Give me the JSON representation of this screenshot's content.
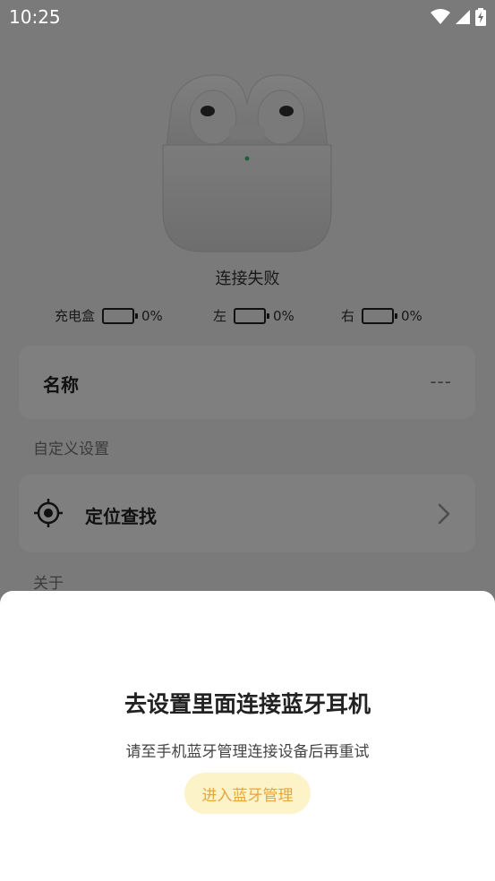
{
  "status_bar": {
    "time": "10:25"
  },
  "device": {
    "connection_status": "连接失败",
    "batteries": [
      {
        "label": "充电盒",
        "percent": "0%"
      },
      {
        "label": "左",
        "percent": "0%"
      },
      {
        "label": "右",
        "percent": "0%"
      }
    ],
    "name_label": "名称",
    "name_value": "---"
  },
  "sections": {
    "custom_settings": "自定义设置",
    "about": "关于"
  },
  "locate": {
    "label": "定位查找"
  },
  "dialog": {
    "title": "去设置里面连接蓝牙耳机",
    "description": "请至手机蓝牙管理连接设备后再重试",
    "button_label": "进入蓝牙管理"
  },
  "colors": {
    "accent_text": "#e9a43a",
    "accent_bg": "#fdf3c8"
  }
}
